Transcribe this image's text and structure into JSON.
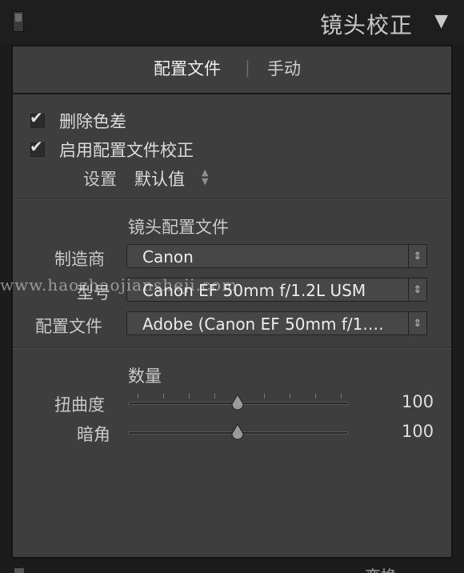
{
  "header": {
    "title": "镜头校正",
    "collapse_icon": "triangle-down-icon"
  },
  "tabs": {
    "profile": "配置文件",
    "separator": "|",
    "manual": "手动"
  },
  "options": {
    "remove_ca": {
      "label": "删除色差",
      "checked": true
    },
    "enable_profile": {
      "label": "启用配置文件校正",
      "checked": true
    },
    "setup_label": "设置",
    "setup_value": "默认值"
  },
  "lens_profile": {
    "section_title": "镜头配置文件",
    "make_label": "制造商",
    "make_value": "Canon",
    "model_label": "型号",
    "model_value": "Canon EF 50mm f/1.2L USM",
    "profile_label": "配置文件",
    "profile_value": "Adobe (Canon EF 50mm f/1.…"
  },
  "amount": {
    "section_title": "数量",
    "distortion_label": "扭曲度",
    "distortion_value": "100",
    "vignetting_label": "暗角",
    "vignetting_value": "100"
  },
  "watermark": "www.haozhaojiansheji.com",
  "next_panel_peek": "变换"
}
